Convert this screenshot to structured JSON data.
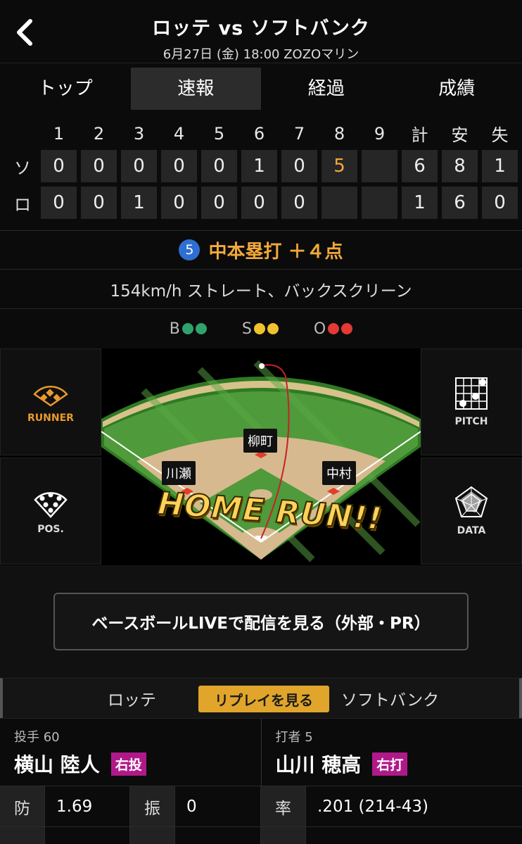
{
  "header": {
    "back_icon": "chevron-left-icon",
    "title": "ロッテ vs ソフトバンク",
    "subtitle": "6月27日 (金) 18:00 ZOZOマリン"
  },
  "tabs": [
    {
      "label": "トップ",
      "active": false
    },
    {
      "label": "速報",
      "active": true
    },
    {
      "label": "経過",
      "active": false
    },
    {
      "label": "成績",
      "active": false
    }
  ],
  "scoreboard": {
    "innings": [
      "1",
      "2",
      "3",
      "4",
      "5",
      "6",
      "7",
      "8",
      "9"
    ],
    "totals_headers": [
      "計",
      "安",
      "失"
    ],
    "rows": [
      {
        "team": "ソ",
        "innings": [
          "0",
          "0",
          "0",
          "0",
          "0",
          "1",
          "0",
          "5",
          ""
        ],
        "totals": [
          "6",
          "8",
          "1"
        ],
        "highlight_inning": 7
      },
      {
        "team": "ロ",
        "innings": [
          "0",
          "0",
          "1",
          "0",
          "0",
          "0",
          "0",
          "",
          ""
        ],
        "totals": [
          "1",
          "6",
          "0"
        ]
      }
    ]
  },
  "play": {
    "batter_number": "5",
    "text": "中本塁打 ＋４点"
  },
  "pitch_desc": "154km/h ストレート、バックスクリーン",
  "count": {
    "b_label": "B",
    "s_label": "S",
    "o_label": "O",
    "b_color": "#2fa36b",
    "s_color": "#f2c12e",
    "o_color": "#e53935"
  },
  "field": {
    "runner_label": "RUNNER",
    "pos_label": "POS.",
    "pitch_label": "PITCH",
    "data_label": "DATA",
    "fielders": {
      "center": "柳町",
      "left": "川瀬",
      "right": "中村"
    },
    "banner": "HOME RUN!!"
  },
  "live_button": "ベースボールLIVEで配信を見る（外部・PR）",
  "team_tabs": {
    "home": "ロッテ",
    "replay": "リプレイを見る",
    "away": "ソフトバンク"
  },
  "pitcher": {
    "role": "投手 60",
    "name": "横山 陸人",
    "hand": "右投"
  },
  "batter": {
    "role": "打者 5",
    "name": "山川 穂高",
    "hand": "右打"
  },
  "stats": {
    "era_key": "防",
    "era_val": "1.69",
    "k_key": "振",
    "k_val": "0",
    "avg_key": "率",
    "avg_val": ".201 (214-43)"
  }
}
